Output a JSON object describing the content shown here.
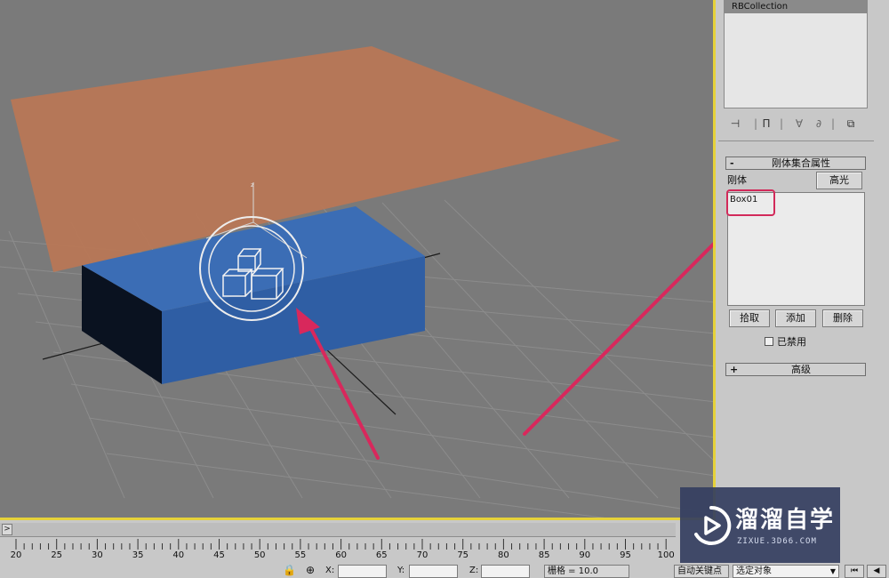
{
  "modifier_stack": {
    "selected_item": "RBCollection"
  },
  "rollout_main": {
    "sign": "-",
    "title": "刚体集合属性"
  },
  "rigid_section": {
    "label": "刚体",
    "highlight_button": "高光",
    "list_items": [
      "Box01"
    ],
    "pick_button": "拾取",
    "add_button": "添加",
    "delete_button": "删除",
    "disabled_label": "已禁用",
    "disabled_checked": false
  },
  "rollout_advanced": {
    "sign": "+",
    "title": "高级"
  },
  "timeline": {
    "slider_arrow": ">",
    "ticks": [
      "20",
      "25",
      "30",
      "35",
      "40",
      "45",
      "50",
      "55",
      "60",
      "65",
      "70",
      "75",
      "80",
      "85",
      "90",
      "95",
      "100"
    ]
  },
  "status": {
    "x_label": "X:",
    "x_value": "",
    "y_label": "Y:",
    "y_value": "",
    "z_label": "Z:",
    "z_value": "",
    "grid_text": "栅格 = 10.0",
    "autokey_label": "自动关键点",
    "select_value": "选定对象"
  },
  "watermark": {
    "title": "溜溜自学",
    "subtitle": "ZIXUE.3D66.COM"
  },
  "colors": {
    "viewport_bg": "#7a7a7a",
    "plane": "#b87756",
    "box_top": "#3b6db5",
    "box_front": "#2f5ea4",
    "box_side": "#0a1220",
    "viewport_border": "#e6d23a",
    "arrow": "#d8285c"
  }
}
